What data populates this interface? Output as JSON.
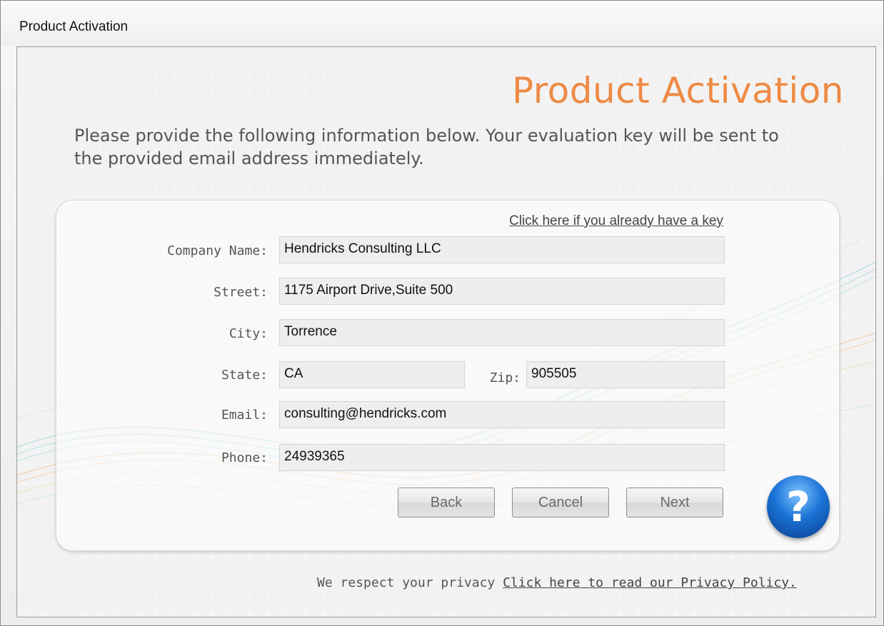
{
  "window": {
    "title": "Product Activation"
  },
  "header": {
    "heading": "Product Activation",
    "intro": "Please provide the following information below. Your evaluation key will be sent to the provided email address immediately."
  },
  "form": {
    "have_key_link": "Click here if you already have a key",
    "company": {
      "label": "Company Name:",
      "value": "Hendricks Consulting LLC"
    },
    "street": {
      "label": "Street:",
      "value": "1175 Airport Drive,Suite 500"
    },
    "city": {
      "label": "City:",
      "value": "Torrence"
    },
    "state": {
      "label": "State:",
      "value": "CA"
    },
    "zip": {
      "label": "Zip:",
      "value": "905505"
    },
    "email": {
      "label": "Email:",
      "value": "consulting@hendricks.com"
    },
    "phone": {
      "label": "Phone:",
      "value": "24939365"
    }
  },
  "buttons": {
    "back": "Back",
    "cancel": "Cancel",
    "next": "Next",
    "help": "?"
  },
  "footer": {
    "privacy_text": "We respect your privacy",
    "privacy_link": "Click here to read our Privacy Policy."
  },
  "colors": {
    "heading": "#ee8a45",
    "help_button": "#1a73d6"
  },
  "icons": {
    "help": "question-mark-icon"
  }
}
